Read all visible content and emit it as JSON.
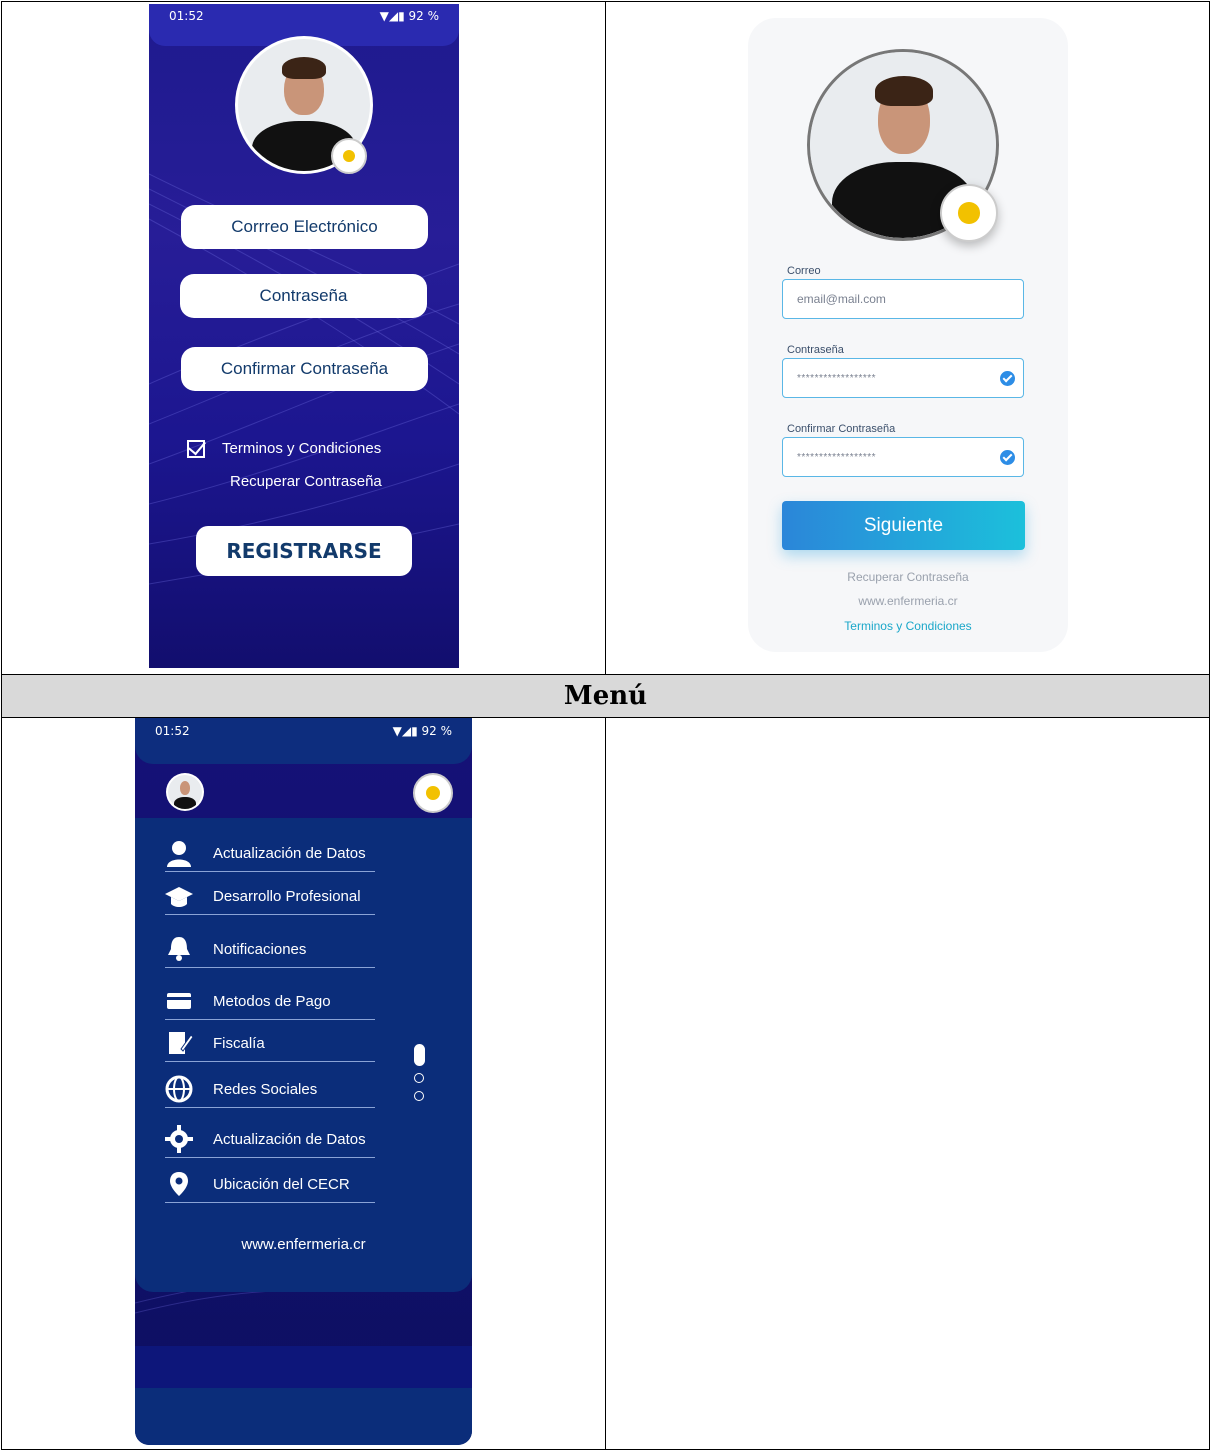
{
  "section_title": "Menú",
  "status_bar": {
    "time": "01:52",
    "battery": "92 %"
  },
  "register_screen": {
    "fields": {
      "email": "Corrreo Electrónico",
      "password": "Contraseña",
      "confirm": "Confirmar Contraseña"
    },
    "terms": "Terminos y Condiciones",
    "recover": "Recuperar Contraseña",
    "submit": "REGISTRARSE"
  },
  "form_screen": {
    "labels": {
      "email": "Correo",
      "password": "Contraseña",
      "confirm": "Confirmar Contraseña"
    },
    "email_placeholder": "email@mail.com",
    "password_value": "******************",
    "confirm_value": "******************",
    "next_button": "Siguiente",
    "recover": "Recuperar Contraseña",
    "website": "www.enfermeria.cr",
    "terms": "Terminos y Condiciones"
  },
  "menu_screen": {
    "items": [
      {
        "label": "Actualización de Datos",
        "icon": "user-icon"
      },
      {
        "label": "Desarrollo Profesional",
        "icon": "graduation-cap-icon"
      },
      {
        "label": "Notificaciones",
        "icon": "bell-icon"
      },
      {
        "label": "Metodos de Pago",
        "icon": "credit-card-icon"
      },
      {
        "label": "Fiscalía",
        "icon": "document-edit-icon"
      },
      {
        "label": "Redes Sociales",
        "icon": "globe-icon"
      },
      {
        "label": "Actualización de Datos",
        "icon": "gear-icon"
      },
      {
        "label": "Ubicación del CECR",
        "icon": "location-pin-icon"
      }
    ],
    "website": "www.enfermeria.cr"
  },
  "colors": {
    "phone_dark": "#1e1a8e",
    "menu_panel": "#0b2d7a",
    "accent_blue": "#2b86d9",
    "accent_cyan": "#1cc0db",
    "link_teal": "#1aa7c9"
  }
}
